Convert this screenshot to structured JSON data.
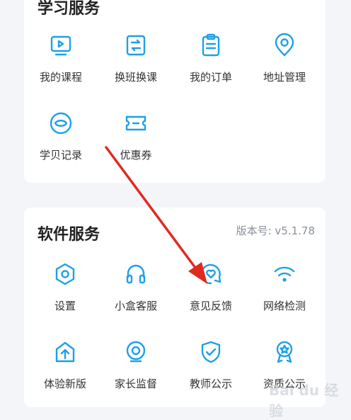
{
  "study_services": {
    "title": "学习服务",
    "items": [
      {
        "label": "我的课程",
        "icon": "play-screen-icon"
      },
      {
        "label": "换班换课",
        "icon": "swap-icon"
      },
      {
        "label": "我的订单",
        "icon": "clipboard-icon"
      },
      {
        "label": "地址管理",
        "icon": "location-pin-icon"
      },
      {
        "label": "学贝记录",
        "icon": "coin-icon"
      },
      {
        "label": "优惠券",
        "icon": "ticket-icon"
      }
    ]
  },
  "software_services": {
    "title": "软件服务",
    "version": "版本号: v5.1.78",
    "items": [
      {
        "label": "设置",
        "icon": "hexagon-settings-icon"
      },
      {
        "label": "小盒客服",
        "icon": "headset-icon"
      },
      {
        "label": "意见反馈",
        "icon": "feedback-heart-icon"
      },
      {
        "label": "网络检测",
        "icon": "wifi-icon"
      },
      {
        "label": "体验新版",
        "icon": "new-version-upload-icon"
      },
      {
        "label": "家长监督",
        "icon": "camera-monitor-icon"
      },
      {
        "label": "教师公示",
        "icon": "shield-check-icon"
      },
      {
        "label": "资质公示",
        "icon": "award-badge-icon"
      }
    ]
  },
  "colors": {
    "accent": "#1ea0e6",
    "annotation_arrow": "#e02a1f",
    "background": "#f3f5f9"
  }
}
